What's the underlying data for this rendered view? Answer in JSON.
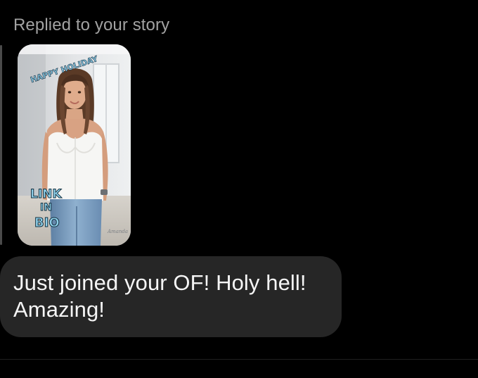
{
  "reply_label": "Replied to your story",
  "story": {
    "sticker_top": "HAPPY HOLIDAY",
    "sticker_link_1": "LINK",
    "sticker_link_2": "IN",
    "sticker_link_3": "BIO",
    "signature": "Amanda"
  },
  "message": {
    "text": "Just joined your OF! Holy hell! Amazing!"
  },
  "colors": {
    "background": "#000000",
    "bubble": "#262626",
    "muted_text": "#a2a2a2",
    "sticker": "#8fd0ea"
  }
}
